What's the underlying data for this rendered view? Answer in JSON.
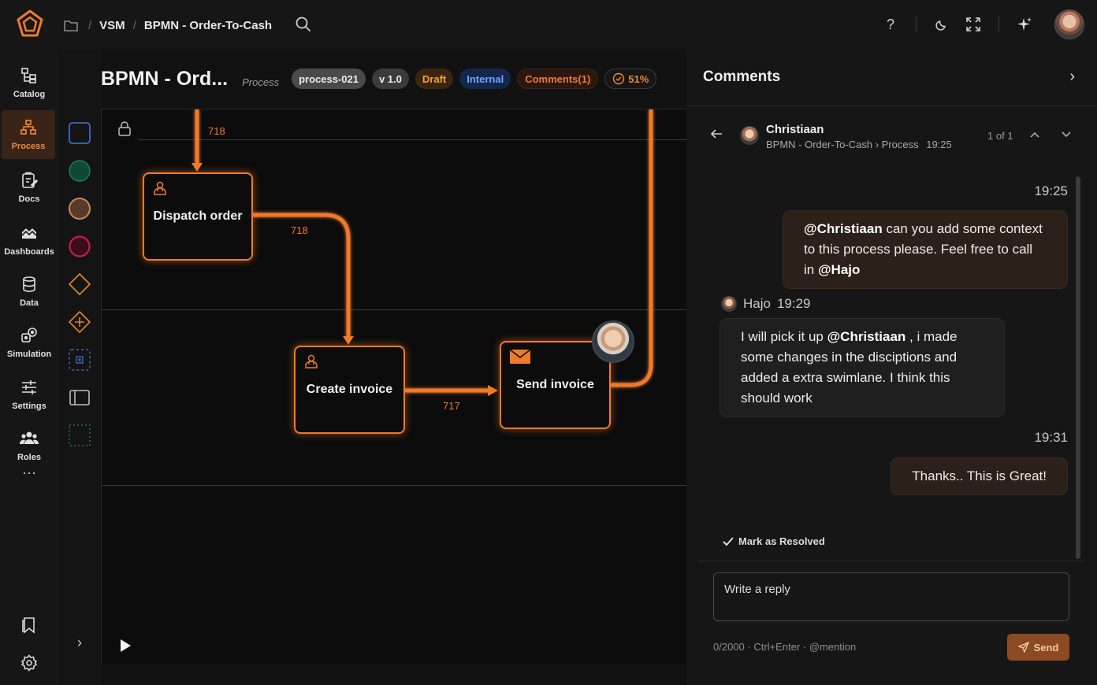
{
  "topbar": {
    "breadcrumb": [
      "VSM",
      "BPMN - Order-To-Cash"
    ],
    "icons": [
      "logo-icon",
      "folder-icon",
      "search-icon",
      "help-icon",
      "moon-icon",
      "fullscreen-icon",
      "sparkle-icon"
    ]
  },
  "nav": {
    "items": [
      {
        "label": "Catalog",
        "icon": "catalog-icon"
      },
      {
        "label": "Process",
        "icon": "process-icon",
        "active": true
      },
      {
        "label": "Docs",
        "icon": "docs-icon"
      },
      {
        "label": "Dashboards",
        "icon": "dashboards-icon"
      },
      {
        "label": "Data",
        "icon": "database-icon"
      },
      {
        "label": "Simulation",
        "icon": "simulation-icon"
      },
      {
        "label": "Settings",
        "icon": "sliders-icon"
      },
      {
        "label": "Roles",
        "icon": "roles-icon"
      }
    ],
    "more": "···"
  },
  "process": {
    "title": "BPMN - Ord...",
    "kind": "Process",
    "badges": {
      "id": "process-021",
      "version": "v 1.0",
      "status": "Draft",
      "visibility": "Internal",
      "comments": "Comments(1)",
      "progress": "51%"
    }
  },
  "diagram": {
    "tasks": [
      {
        "label": "Dispatch order",
        "icon": "user-task-icon"
      },
      {
        "label": "Create invoice",
        "icon": "user-task-icon"
      },
      {
        "label": "Send invoice",
        "icon": "send-task-icon"
      }
    ],
    "edge_labels": [
      "718",
      "718",
      "717"
    ]
  },
  "comments": {
    "title": "Comments",
    "thread": {
      "author": "Christiaan",
      "path": "BPMN - Order-To-Cash › Process",
      "time": "19:25",
      "count": "1 of 1"
    },
    "messages": [
      {
        "time": "19:25",
        "mention1": "@Christiaan",
        "text1": " can you add some context to this process please. Feel free to call in ",
        "mention2": "@Hajo"
      },
      {
        "author": "Hajo",
        "time": "19:29",
        "text1": "I will pick it up ",
        "mention1": "@Christiaan",
        "text2": " , i made some changes in the disciptions and added a extra swimlane. I think this should work"
      },
      {
        "time": "19:31",
        "text": "Thanks.. This is Great!"
      }
    ],
    "resolve_label": "Mark as Resolved",
    "reply_placeholder": "Write a reply",
    "hint": "0/2000 · Ctrl+Enter · @mention",
    "send_label": "Send"
  },
  "colors": {
    "accent": "#f07a2a",
    "background": "#111111",
    "panel": "#161616"
  }
}
